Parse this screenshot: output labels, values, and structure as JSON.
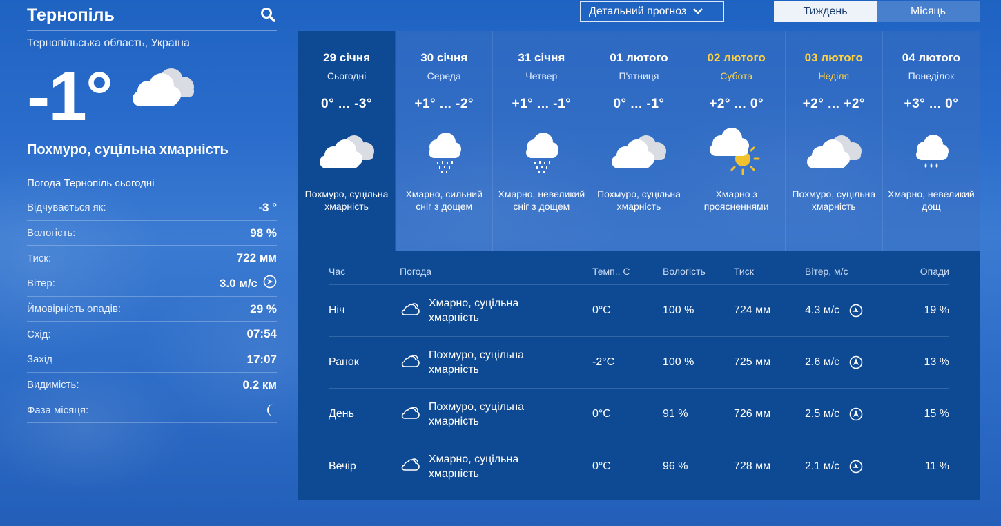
{
  "location": {
    "city": "Тернопіль",
    "region": "Тернопільська область, Україна"
  },
  "current": {
    "temp": "-1°",
    "description": "Похмуро, суцільна хмарність",
    "icon": "cloudy-icon"
  },
  "today": {
    "title": "Погода Тернопіль сьогодні",
    "params": [
      {
        "label": "Відчувається як:",
        "value": "-3 °"
      },
      {
        "label": "Вологість:",
        "value": "98 %"
      },
      {
        "label": "Тиск:",
        "value": "722 мм"
      },
      {
        "label": "Вітер:",
        "value": "3.0 м/с",
        "icon": "wind-direction-icon"
      },
      {
        "label": "Ймовірність опадів:",
        "value": "29 %"
      },
      {
        "label": "Схід:",
        "value": "07:54"
      },
      {
        "label": "Захід",
        "value": "17:07"
      },
      {
        "label": "Видимість:",
        "value": "0.2 км"
      },
      {
        "label": "Фаза місяця:",
        "value": "",
        "icon": "moon-phase-icon"
      }
    ]
  },
  "controls": {
    "detail_select": "Детальний прогноз",
    "tabs": [
      {
        "label": "Тиждень",
        "active": true
      },
      {
        "label": "Місяць",
        "active": false
      }
    ]
  },
  "days": [
    {
      "date": "29 січня",
      "name": "Сьогодні",
      "temp": "0° ... -3°",
      "icon": "cloudy-icon",
      "desc": "Похмуро, суцільна хмарність",
      "active": true,
      "weekend": false
    },
    {
      "date": "30 січня",
      "name": "Середа",
      "temp": "+1° ... -2°",
      "icon": "snow-rain-icon",
      "desc": "Хмарно, сильний сніг з дощем",
      "active": false,
      "weekend": false
    },
    {
      "date": "31 січня",
      "name": "Четвер",
      "temp": "+1° ... -1°",
      "icon": "snow-rain-icon",
      "desc": "Хмарно, невеликий сніг з дощем",
      "active": false,
      "weekend": false
    },
    {
      "date": "01 лютого",
      "name": "П'ятниця",
      "temp": "0° ... -1°",
      "icon": "cloudy-icon",
      "desc": "Похмуро, суцільна хмарність",
      "active": false,
      "weekend": false
    },
    {
      "date": "02 лютого",
      "name": "Субота",
      "temp": "+2° ... 0°",
      "icon": "partly-sunny-icon",
      "desc": "Хмарно з проясненнями",
      "active": false,
      "weekend": true
    },
    {
      "date": "03 лютого",
      "name": "Неділя",
      "temp": "+2° ... +2°",
      "icon": "cloudy-icon",
      "desc": "Похмуро, суцільна хмарність",
      "active": false,
      "weekend": true
    },
    {
      "date": "04 лютого",
      "name": "Понеділок",
      "temp": "+3° ... 0°",
      "icon": "rain-icon",
      "desc": "Хмарно, невеликий дощ",
      "active": false,
      "weekend": false
    }
  ],
  "hourly": {
    "headers": {
      "time": "Час",
      "weather": "Погода",
      "temp": "Темп., С",
      "humidity": "Вологість",
      "pressure": "Тиск",
      "wind": "Вітер, м/с",
      "precip": "Опади"
    },
    "rows": [
      {
        "time": "Ніч",
        "weather": "Хмарно, суцільна хмарність",
        "temp": "0°C",
        "humidity": "100 %",
        "pressure": "724 мм",
        "wind": "4.3 м/с",
        "wind_dir": "south-east",
        "precip": "19 %"
      },
      {
        "time": "Ранок",
        "weather": "Похмуро, суцільна хмарність",
        "temp": "-2°C",
        "humidity": "100 %",
        "pressure": "725 мм",
        "wind": "2.6 м/с",
        "wind_dir": "north",
        "precip": "13 %"
      },
      {
        "time": "День",
        "weather": "Похмуро, суцільна хмарність",
        "temp": "0°C",
        "humidity": "91 %",
        "pressure": "726 мм",
        "wind": "2.5 м/с",
        "wind_dir": "north",
        "precip": "15 %"
      },
      {
        "time": "Вечір",
        "weather": "Хмарно, суцільна хмарність",
        "temp": "0°C",
        "humidity": "96 %",
        "pressure": "728 мм",
        "wind": "2.1 м/с",
        "wind_dir": "south-east",
        "precip": "11 %"
      }
    ]
  }
}
